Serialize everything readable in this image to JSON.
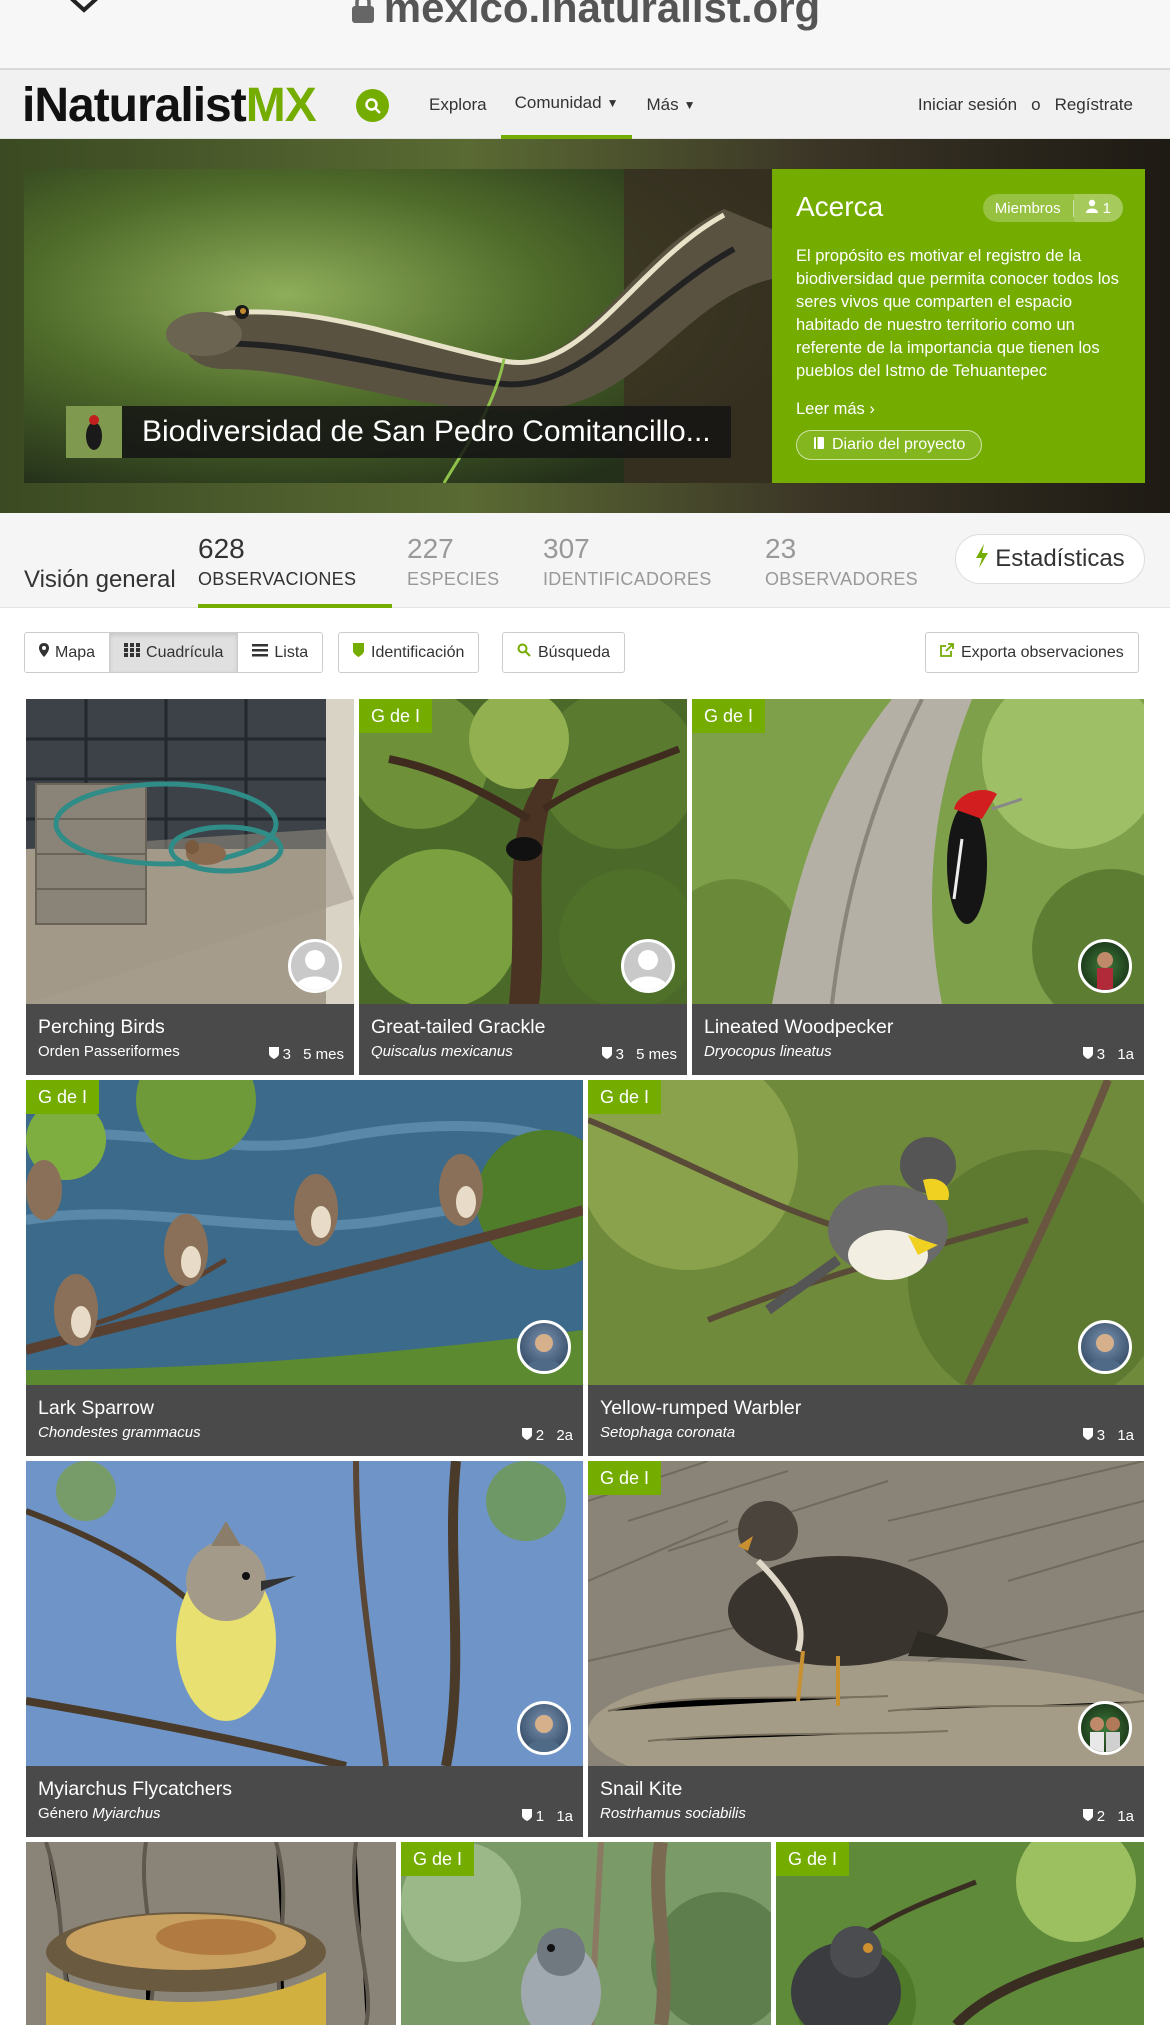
{
  "browser": {
    "url": "mexico.inaturalist.org"
  },
  "header": {
    "logo_main": "iNaturalist",
    "logo_suffix": "MX",
    "nav": [
      {
        "label": "Explora"
      },
      {
        "label": "Comunidad"
      },
      {
        "label": "Más"
      }
    ],
    "login": "Iniciar sesión",
    "or": "o",
    "signup": "Regístrate"
  },
  "hero": {
    "project_title": "Biodiversidad de San Pedro Comitancillo...",
    "about_title": "Acerca",
    "members_label": "Miembros",
    "members_count": "1",
    "description": "El propósito es motivar el registro de la biodiversidad que permita conocer todos los seres vivos que comparten el espacio habitado de nuestro territorio como un referente de la importancia que tienen los pueblos del Istmo de Tehuantepec",
    "read_more": "Leer más",
    "journal": "Diario del proyecto"
  },
  "stats": {
    "overview": "Visión general",
    "items": [
      {
        "num": "628",
        "label": "OBSERVACIONES"
      },
      {
        "num": "227",
        "label": "ESPECIES"
      },
      {
        "num": "307",
        "label": "IDENTIFICADORES"
      },
      {
        "num": "23",
        "label": "OBSERVADORES"
      }
    ],
    "stats_button": "Estadísticas"
  },
  "filters": {
    "map": "Mapa",
    "grid": "Cuadrícula",
    "list": "Lista",
    "identification": "Identificación",
    "search": "Búsqueda",
    "export": "Exporta observaciones"
  },
  "observations": [
    {
      "name": "Perching Birds",
      "sci": "Orden Passeriformes",
      "ids": "3",
      "age": "5 mes",
      "badge": ""
    },
    {
      "name": "Great-tailed Grackle",
      "sci": "Quiscalus mexicanus",
      "ids": "3",
      "age": "5 mes",
      "badge": "G de I"
    },
    {
      "name": "Lineated Woodpecker",
      "sci": "Dryocopus lineatus",
      "ids": "3",
      "age": "1a",
      "badge": "G de I"
    },
    {
      "name": "Lark Sparrow",
      "sci": "Chondestes grammacus",
      "ids": "2",
      "age": "2a",
      "badge": "G de I"
    },
    {
      "name": "Yellow-rumped Warbler",
      "sci": "Setophaga coronata",
      "ids": "3",
      "age": "1a",
      "badge": "G de I"
    },
    {
      "name": "Myiarchus Flycatchers",
      "sci_prefix": "Género ",
      "sci": "Myiarchus",
      "ids": "1",
      "age": "1a",
      "badge": ""
    },
    {
      "name": "Snail Kite",
      "sci": "Rostrhamus sociabilis",
      "ids": "2",
      "age": "1a",
      "badge": "G de I"
    },
    {
      "badge": ""
    },
    {
      "badge": "G de I"
    },
    {
      "badge": "G de I"
    }
  ],
  "colors": {
    "brand_green": "#74ac00",
    "caption_bg": "#4a4a4a"
  }
}
